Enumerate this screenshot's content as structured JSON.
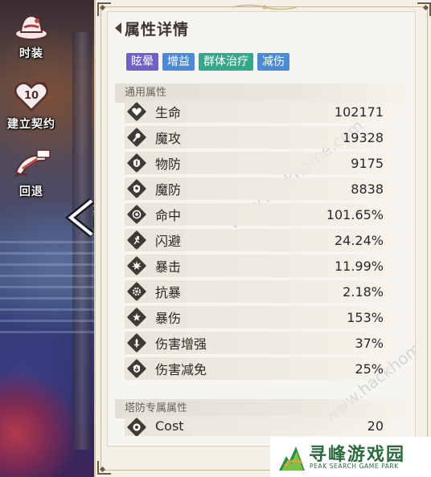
{
  "side_menu": [
    {
      "label": "时装",
      "icon": "hat-icon"
    },
    {
      "label": "建立契约",
      "icon": "heart-contract-icon",
      "badge": "10"
    },
    {
      "label": "回退",
      "icon": "rewind-scroll-icon"
    }
  ],
  "return_button": {
    "label": "返回"
  },
  "panel": {
    "title": "属性详情",
    "tags": [
      {
        "label": "眩晕",
        "color": "#7161c4"
      },
      {
        "label": "增益",
        "color": "#4c8bd4"
      },
      {
        "label": "群体治疗",
        "color": "#36a889"
      },
      {
        "label": "减伤",
        "color": "#4c8bd4"
      }
    ],
    "sections": {
      "general": {
        "title": "通用属性",
        "stats": [
          {
            "name": "生命",
            "value": "102171",
            "icon": "heart-icon"
          },
          {
            "name": "魔攻",
            "value": "19328",
            "icon": "magic-wand-icon"
          },
          {
            "name": "物防",
            "value": "9175",
            "icon": "shield-sword-icon"
          },
          {
            "name": "魔防",
            "value": "8838",
            "icon": "shield-magic-icon"
          },
          {
            "name": "命中",
            "value": "101.65%",
            "icon": "target-icon"
          },
          {
            "name": "闪避",
            "value": "24.24%",
            "icon": "running-figure-icon"
          },
          {
            "name": "暴击",
            "value": "11.99%",
            "icon": "burst-icon"
          },
          {
            "name": "抗暴",
            "value": "2.18%",
            "icon": "gear-shield-icon"
          },
          {
            "name": "暴伤",
            "value": "153%",
            "icon": "star-burst-icon"
          },
          {
            "name": "伤害增强",
            "value": "37%",
            "icon": "sword-up-icon"
          },
          {
            "name": "伤害减免",
            "value": "25%",
            "icon": "shield-down-icon"
          }
        ]
      },
      "tower": {
        "title": "塔防专属属性",
        "stats": [
          {
            "name": "Cost",
            "value": "20",
            "icon": "cost-icon"
          }
        ]
      }
    }
  },
  "watermark": "www.hackhome.com",
  "logo": {
    "cn": "寻峰游戏园",
    "en": "PEAK SEARCH GAME PARK"
  }
}
